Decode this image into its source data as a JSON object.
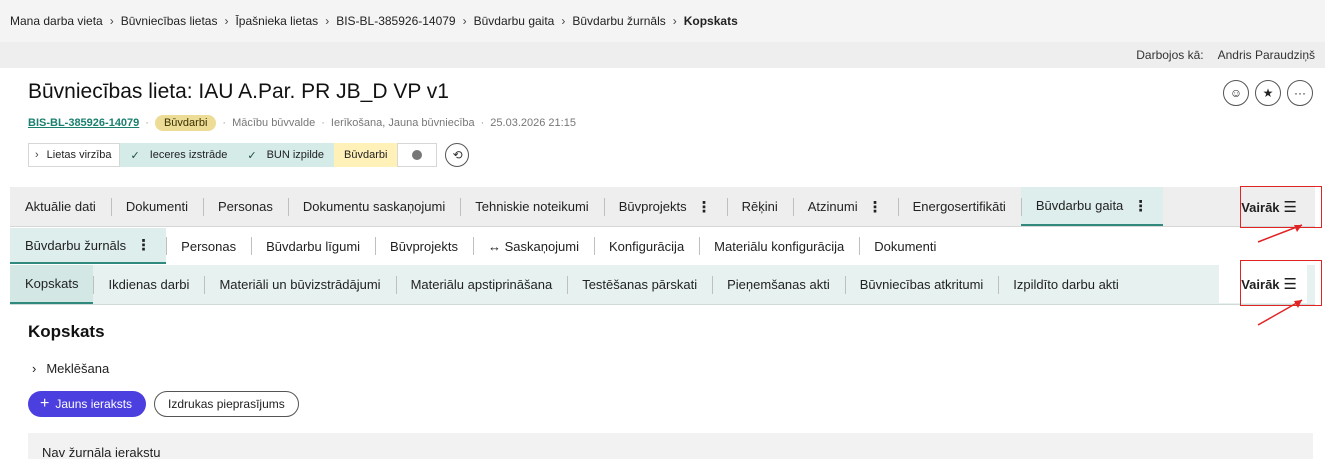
{
  "breadcrumb": {
    "items": [
      "Mana darba vieta",
      "Būvniecības lietas",
      "Īpašnieka lietas",
      "BIS-BL-385926-14079",
      "Būvdarbu gaita",
      "Būvdarbu žurnāls"
    ],
    "current": "Kopskats"
  },
  "acting_as": {
    "label": "Darbojos kā:",
    "user": "Andris Paraudziņš"
  },
  "header": {
    "title": "Būvniecības lieta: IAU A.Par. PR JB_D VP v1",
    "case_id": "BIS-BL-385926-14079",
    "status_badge": "Būvdarbi",
    "authority": "Mācību būvvalde",
    "case_type": "Ierīkošana, Jauna būvniecība",
    "datetime": "25.03.2026 21:15",
    "actions": [
      {
        "name": "person-icon",
        "glyph": "☺"
      },
      {
        "name": "star-icon",
        "glyph": "★"
      },
      {
        "name": "more-icon",
        "glyph": "···"
      }
    ]
  },
  "progress": {
    "toggle_label": "Lietas virzība",
    "steps": [
      {
        "label": "Ieceres izstrāde",
        "state": "done"
      },
      {
        "label": "BUN izpilde",
        "state": "done"
      },
      {
        "label": "Būvdarbi",
        "state": "active"
      }
    ],
    "history_icon": "history-icon"
  },
  "tabs_main": {
    "items": [
      {
        "label": "Aktuālie dati",
        "kebab": false,
        "selected": false
      },
      {
        "label": "Dokumenti",
        "kebab": false,
        "selected": false
      },
      {
        "label": "Personas",
        "kebab": false,
        "selected": false
      },
      {
        "label": "Dokumentu saskaņojumi",
        "kebab": false,
        "selected": false
      },
      {
        "label": "Tehniskie noteikumi",
        "kebab": false,
        "selected": false
      },
      {
        "label": "Būvprojekts",
        "kebab": true,
        "selected": false
      },
      {
        "label": "Rēķini",
        "kebab": false,
        "selected": false
      },
      {
        "label": "Atzinumi",
        "kebab": true,
        "selected": false
      },
      {
        "label": "Energosertifikāti",
        "kebab": false,
        "selected": false
      },
      {
        "label": "Būvdarbu gaita",
        "kebab": true,
        "selected": true
      }
    ],
    "more_label": "Vairāk"
  },
  "tabs_sub": {
    "items": [
      {
        "label": "Būvdarbu žurnāls",
        "kebab": true,
        "selected": true
      },
      {
        "label": "Personas",
        "kebab": false,
        "selected": false
      },
      {
        "label": "Būvdarbu līgumi",
        "kebab": false,
        "selected": false
      },
      {
        "label": "Būvprojekts",
        "kebab": false,
        "selected": false
      },
      {
        "label": "↔ Saskaņojumi",
        "kebab": false,
        "selected": false
      },
      {
        "label": "Konfigurācija",
        "kebab": false,
        "selected": false
      },
      {
        "label": "Materiālu konfigurācija",
        "kebab": false,
        "selected": false
      },
      {
        "label": "Dokumenti",
        "kebab": false,
        "selected": false
      }
    ]
  },
  "tabs_journal": {
    "items": [
      {
        "label": "Kopskats",
        "selected": true
      },
      {
        "label": "Ikdienas darbi",
        "selected": false
      },
      {
        "label": "Materiāli un būvizstrādājumi",
        "selected": false
      },
      {
        "label": "Materiālu apstiprināšana",
        "selected": false
      },
      {
        "label": "Testēšanas pārskati",
        "selected": false
      },
      {
        "label": "Pieņemšanas akti",
        "selected": false
      },
      {
        "label": "Būvniecības atkritumi",
        "selected": false
      },
      {
        "label": "Izpildīto darbu akti",
        "selected": false
      }
    ],
    "more_label": "Vairāk"
  },
  "content": {
    "section_title": "Kopskats",
    "search_toggle": "Meklēšana",
    "new_entry_button": "Jauns ieraksts",
    "print_request_button": "Izdrukas pieprasījums",
    "empty_message": "Nav žurnāla ierakstu"
  },
  "colors": {
    "accent_teal": "#2f8a7d",
    "primary_button": "#4b3fe0",
    "badge_bg": "#eddc96",
    "annotation_red": "#e02323"
  }
}
